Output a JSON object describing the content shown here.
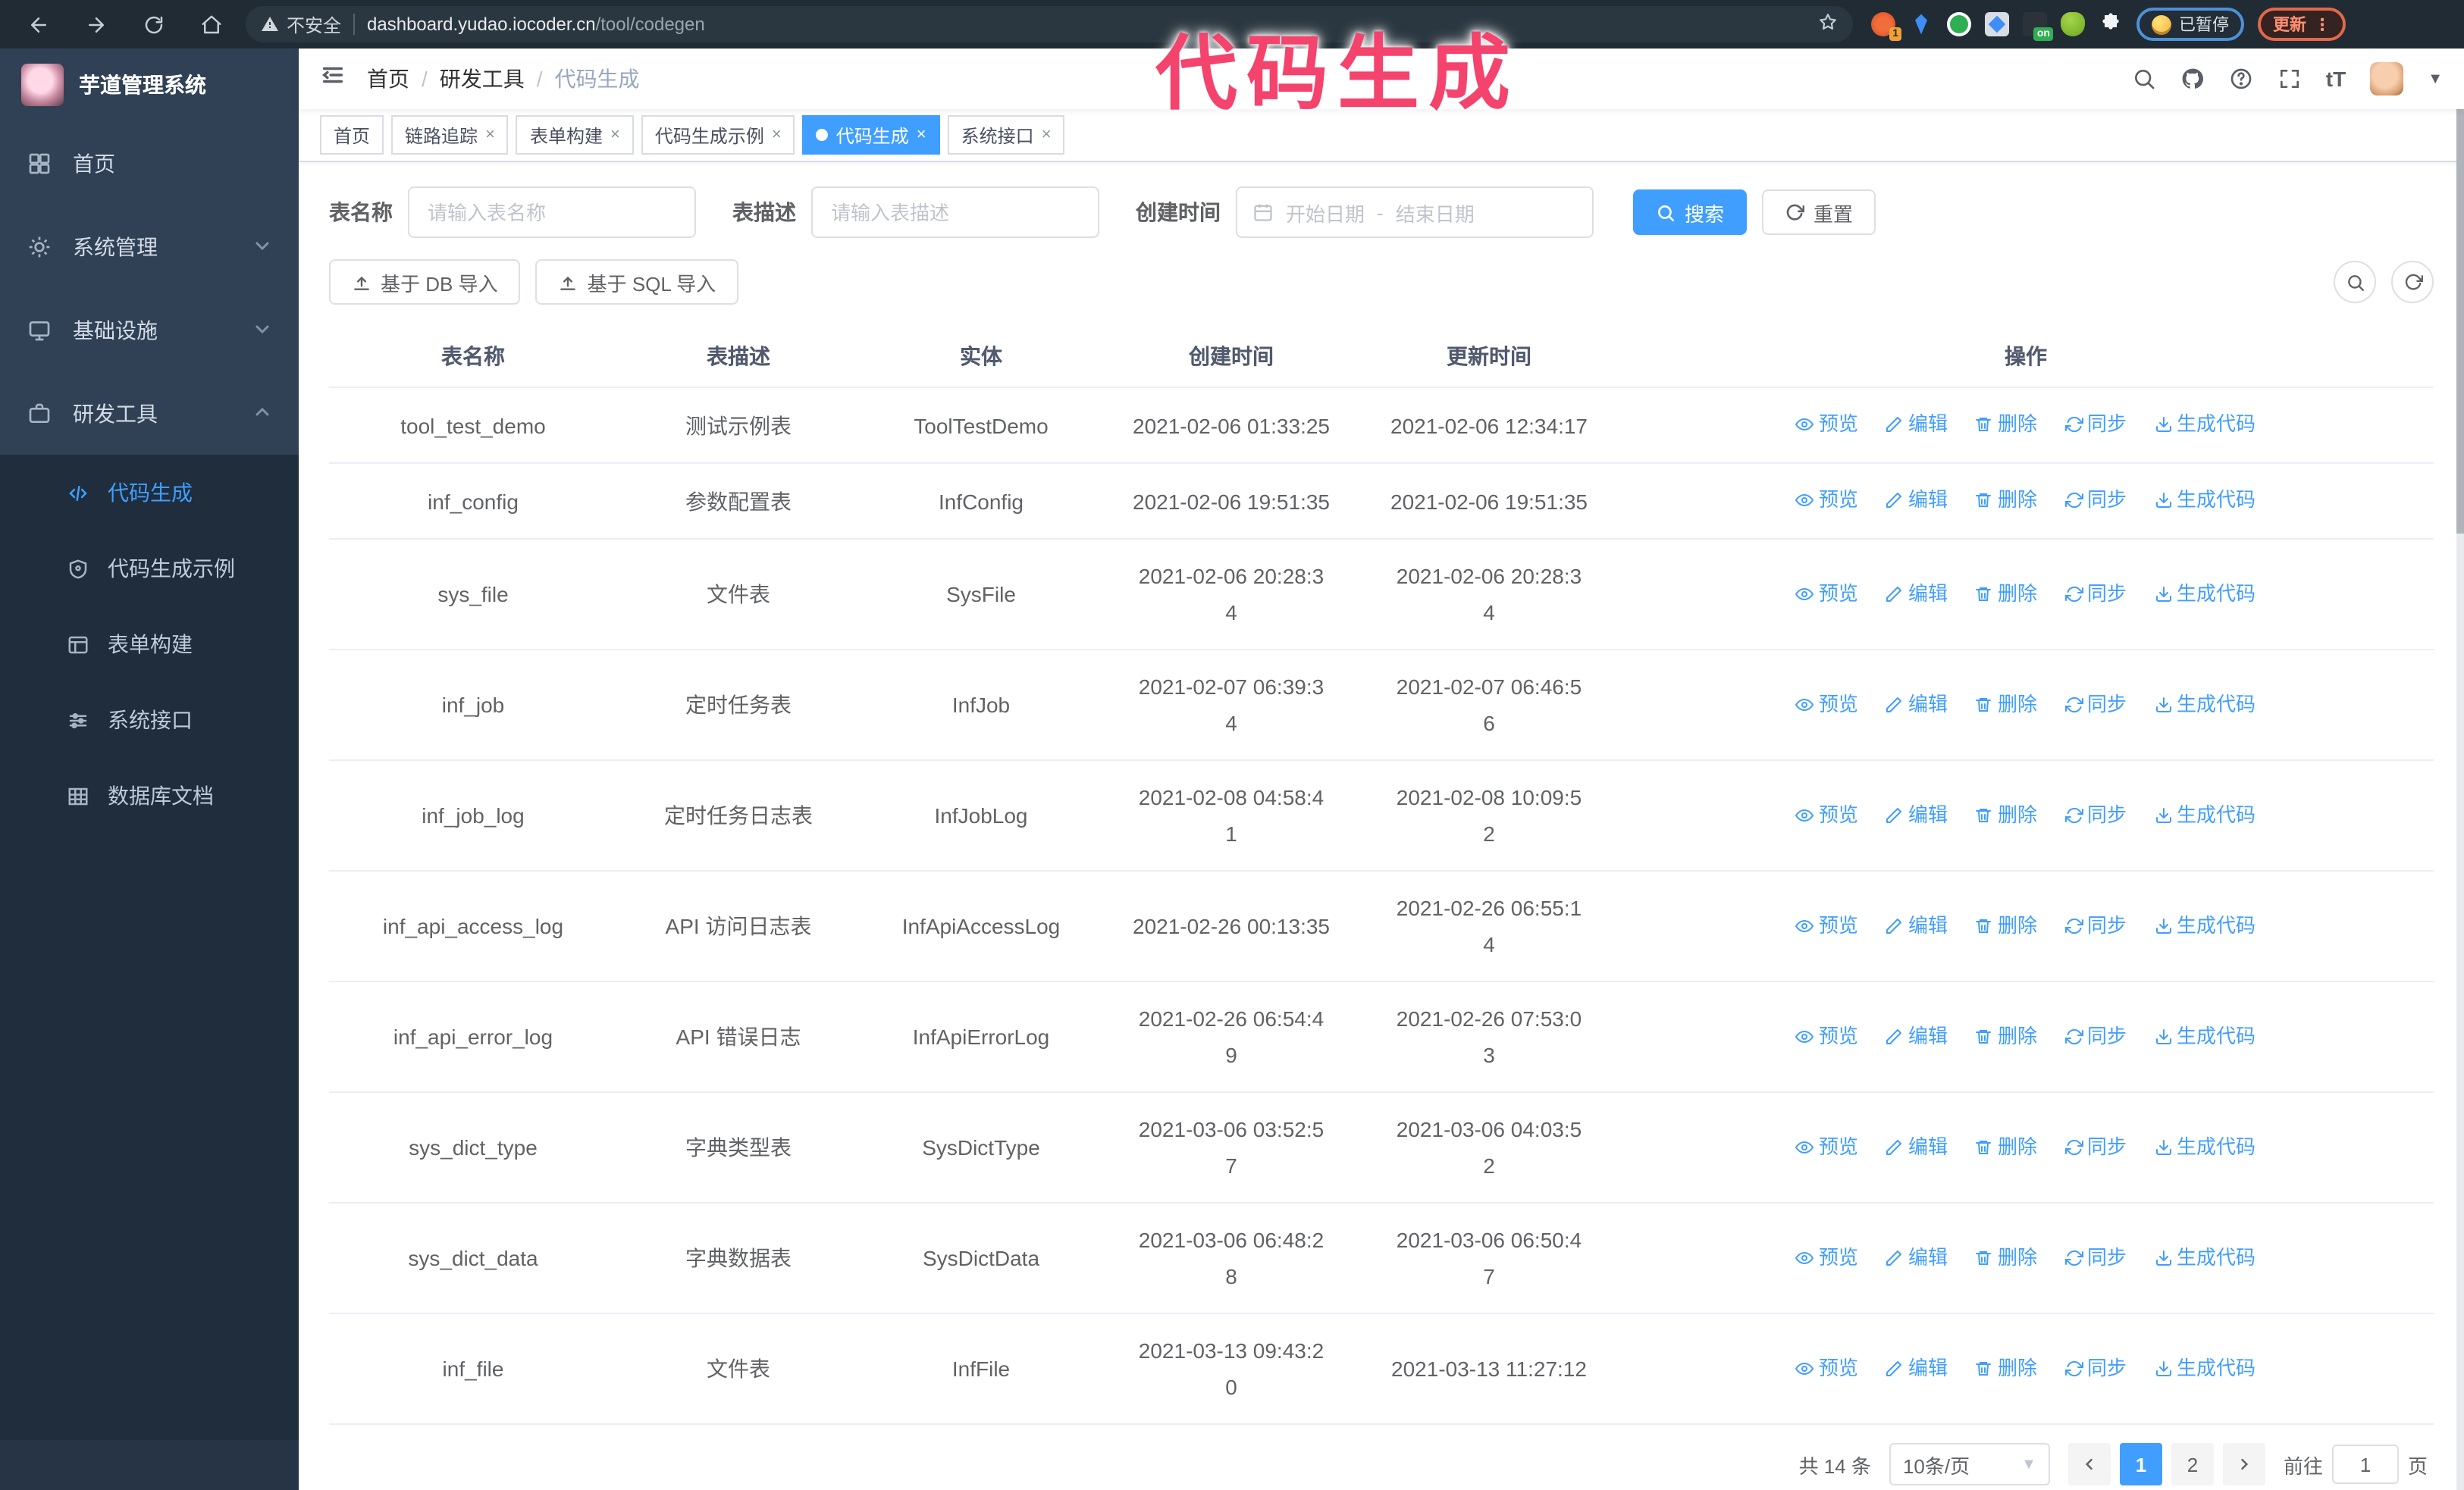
{
  "browser": {
    "not_secure": "不安全",
    "url_host": "dashboard.yudao.iocoder.cn",
    "url_path": "/tool/codegen",
    "ext_badge": "1",
    "ext_on_badge": "on",
    "paused_label": "已暂停",
    "update_label": "更新"
  },
  "annotation": "代码生成",
  "sidebar": {
    "title": "芋道管理系统",
    "items": [
      {
        "label": "首页"
      },
      {
        "label": "系统管理"
      },
      {
        "label": "基础设施"
      },
      {
        "label": "研发工具"
      }
    ],
    "submenu": [
      {
        "label": "代码生成"
      },
      {
        "label": "代码生成示例"
      },
      {
        "label": "表单构建"
      },
      {
        "label": "系统接口"
      },
      {
        "label": "数据库文档"
      }
    ]
  },
  "breadcrumb": {
    "items": [
      "首页",
      "研发工具",
      "代码生成"
    ]
  },
  "tabs": [
    {
      "label": "首页"
    },
    {
      "label": "链路追踪"
    },
    {
      "label": "表单构建"
    },
    {
      "label": "代码生成示例"
    },
    {
      "label": "代码生成"
    },
    {
      "label": "系统接口"
    }
  ],
  "filters": {
    "name_label": "表名称",
    "name_placeholder": "请输入表名称",
    "desc_label": "表描述",
    "desc_placeholder": "请输入表描述",
    "time_label": "创建时间",
    "start_placeholder": "开始日期",
    "range_separator": "-",
    "end_placeholder": "结束日期",
    "search_label": "搜索",
    "reset_label": "重置"
  },
  "toolbar": {
    "db_import_label": "基于 DB 导入",
    "sql_import_label": "基于 SQL 导入"
  },
  "table": {
    "columns": [
      "表名称",
      "表描述",
      "实体",
      "创建时间",
      "更新时间",
      "操作"
    ],
    "actions": [
      "预览",
      "编辑",
      "删除",
      "同步",
      "生成代码"
    ],
    "rows": [
      {
        "name": "tool_test_demo",
        "desc": "测试示例表",
        "entity": "ToolTestDemo",
        "created": "2021-02-06 01:33:25",
        "updated": "2021-02-06 12:34:17"
      },
      {
        "name": "inf_config",
        "desc": "参数配置表",
        "entity": "InfConfig",
        "created": "2021-02-06 19:51:35",
        "updated": "2021-02-06 19:51:35"
      },
      {
        "name": "sys_file",
        "desc": "文件表",
        "entity": "SysFile",
        "created": "2021-02-06 20:28:3\n4",
        "updated": "2021-02-06 20:28:3\n4"
      },
      {
        "name": "inf_job",
        "desc": "定时任务表",
        "entity": "InfJob",
        "created": "2021-02-07 06:39:3\n4",
        "updated": "2021-02-07 06:46:5\n6"
      },
      {
        "name": "inf_job_log",
        "desc": "定时任务日志表",
        "entity": "InfJobLog",
        "created": "2021-02-08 04:58:4\n1",
        "updated": "2021-02-08 10:09:5\n2"
      },
      {
        "name": "inf_api_access_log",
        "desc": "API 访问日志表",
        "entity": "InfApiAccessLog",
        "created": "2021-02-26 00:13:35",
        "updated": "2021-02-26 06:55:1\n4"
      },
      {
        "name": "inf_api_error_log",
        "desc": "API 错误日志",
        "entity": "InfApiErrorLog",
        "created": "2021-02-26 06:54:4\n9",
        "updated": "2021-02-26 07:53:0\n3"
      },
      {
        "name": "sys_dict_type",
        "desc": "字典类型表",
        "entity": "SysDictType",
        "created": "2021-03-06 03:52:5\n7",
        "updated": "2021-03-06 04:03:5\n2"
      },
      {
        "name": "sys_dict_data",
        "desc": "字典数据表",
        "entity": "SysDictData",
        "created": "2021-03-06 06:48:2\n8",
        "updated": "2021-03-06 06:50:4\n7"
      },
      {
        "name": "inf_file",
        "desc": "文件表",
        "entity": "InfFile",
        "created": "2021-03-13 09:43:2\n0",
        "updated": "2021-03-13 11:27:12"
      }
    ]
  },
  "pagination": {
    "total": "共 14 条",
    "page_size": "10条/页",
    "pages": [
      "1",
      "2"
    ],
    "goto_label": "前往",
    "goto_value": "1",
    "page_suffix": "页"
  }
}
